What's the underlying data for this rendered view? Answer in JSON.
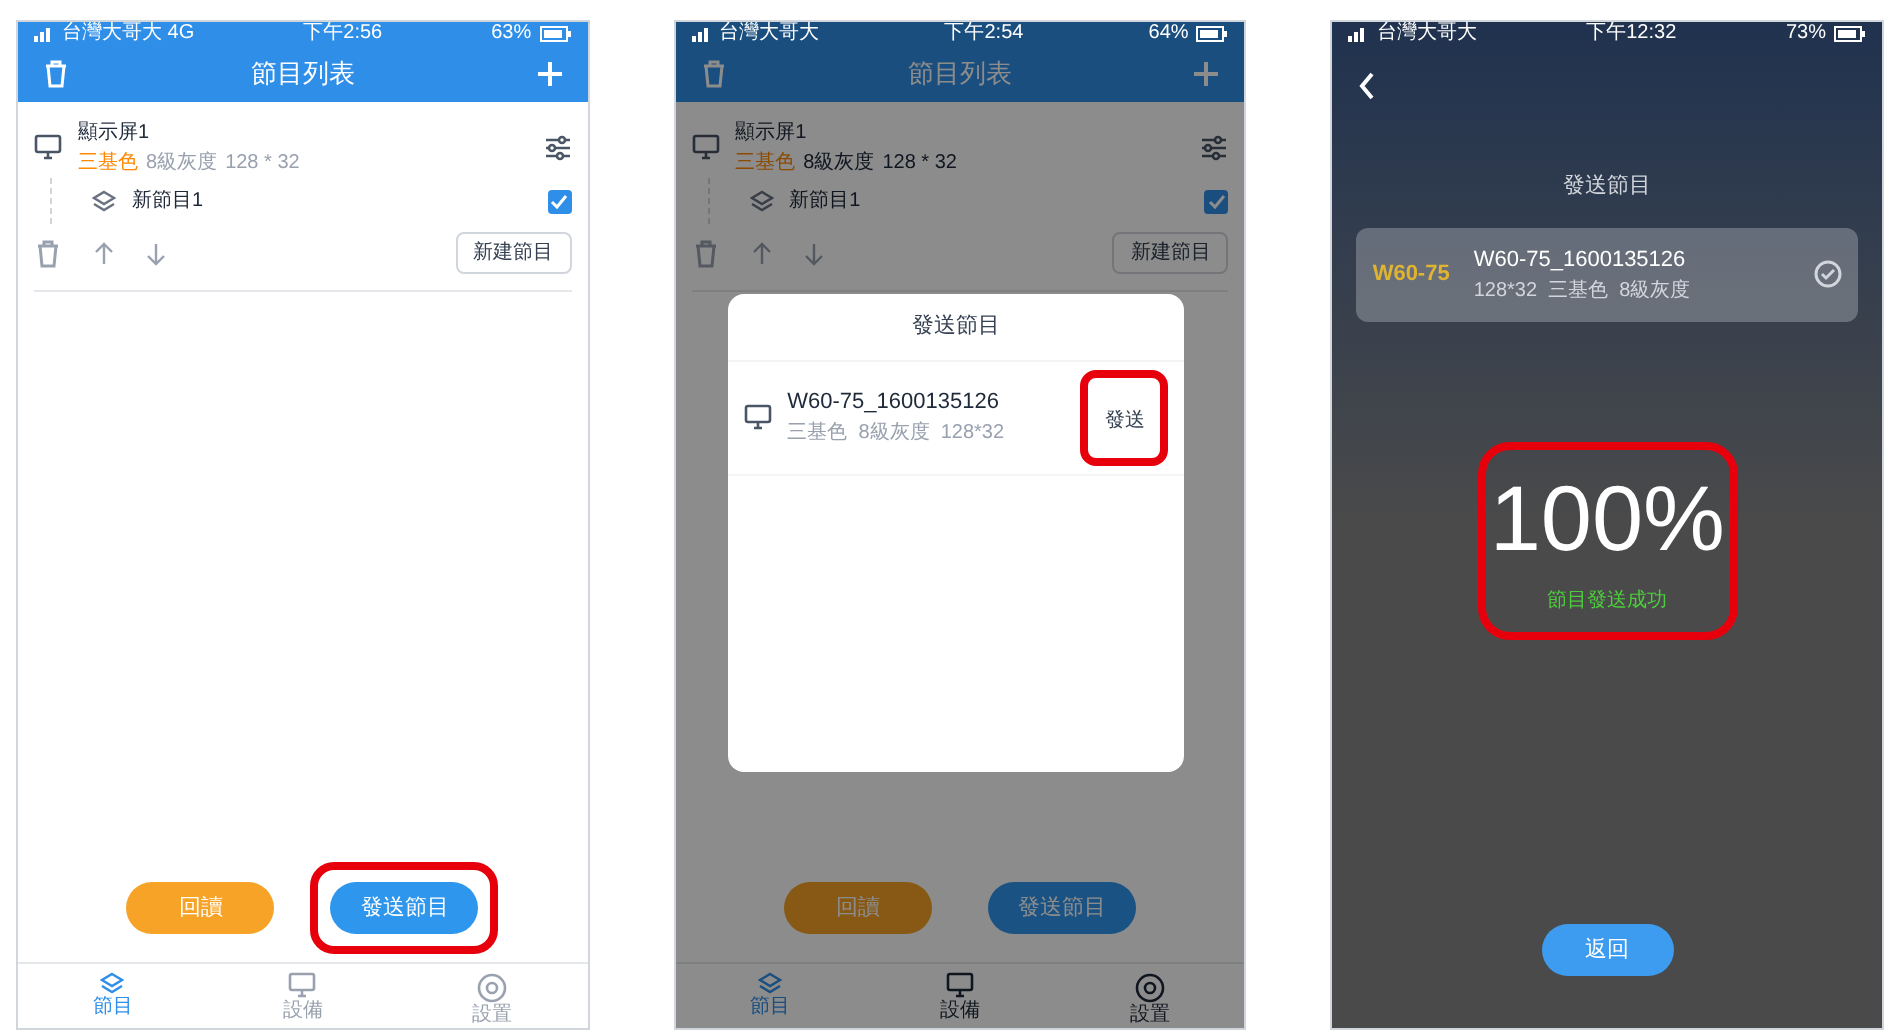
{
  "screens": [
    {
      "kind": "program_list",
      "dimmed": false,
      "status_bar": {
        "carrier": "台灣大哥大 4G",
        "time": "下午2:56",
        "battery": "63%"
      },
      "title": "節目列表",
      "display": {
        "name": "顯示屏1",
        "color_mode": "三基色",
        "grayscale": "8級灰度",
        "resolution": "128 * 32"
      },
      "programs": [
        {
          "name": "新節目1",
          "checked": true
        }
      ],
      "new_program_button": "新建節目",
      "actions": [
        {
          "label": "回讀",
          "kind": "secondary",
          "highlighted": false
        },
        {
          "label": "發送節目",
          "kind": "primary",
          "highlighted": true
        }
      ],
      "tabs": [
        {
          "label": "節目",
          "selected": true
        },
        {
          "label": "設備",
          "selected": false
        },
        {
          "label": "設置",
          "selected": false
        }
      ]
    },
    {
      "kind": "program_list",
      "dimmed": true,
      "status_bar": {
        "carrier": "台灣大哥大",
        "time": "下午2:54",
        "battery": "64%"
      },
      "title": "節目列表",
      "display": {
        "name": "顯示屏1",
        "color_mode": "三基色",
        "grayscale": "8級灰度",
        "resolution": "128 * 32"
      },
      "programs": [
        {
          "name": "新節目1",
          "checked": true
        }
      ],
      "new_program_button": "新建節目",
      "actions": [
        {
          "label": "回讀",
          "kind": "secondary",
          "highlighted": false
        },
        {
          "label": "發送節目",
          "kind": "primary",
          "highlighted": false
        }
      ],
      "tabs": [
        {
          "label": "節目",
          "selected": true
        },
        {
          "label": "設備",
          "selected": false
        },
        {
          "label": "設置",
          "selected": false
        }
      ],
      "dialog": {
        "title": "發送節目",
        "devices": [
          {
            "name": "W60-75_1600135126",
            "details": "三基色  8級灰度  128*32",
            "send_label": "發送",
            "highlighted": true
          }
        ]
      }
    },
    {
      "kind": "send_progress",
      "status_bar": {
        "carrier": "台灣大哥大",
        "time": "下午12:32",
        "battery": "73%"
      },
      "title": "發送節目",
      "device": {
        "tag": "W60-75",
        "name": "W60-75_1600135126",
        "details": "128*32  三基色  8級灰度"
      },
      "percent": "100%",
      "message": "節目發送成功",
      "highlighted": true,
      "back_button": "返回"
    }
  ]
}
